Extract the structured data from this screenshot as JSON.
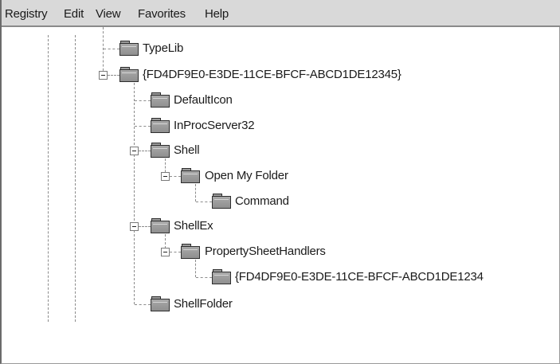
{
  "menubar": {
    "registry": "Registry",
    "edit": "Edit",
    "view": "View",
    "favorites": "Favorites",
    "help": "Help"
  },
  "tree": {
    "typelib": "TypeLib",
    "clsid_root": "{FD4DF9E0-E3DE-11CE-BFCF-ABCD1DE12345}",
    "defaulticon": "DefaultIcon",
    "inprocserver32": "InProcServer32",
    "shell": "Shell",
    "open_my_folder": "Open My Folder",
    "command": "Command",
    "shellex": "ShellEx",
    "propertysheethandlers": "PropertySheetHandlers",
    "clsid_handler": "{FD4DF9E0-E3DE-11CE-BFCF-ABCD1DE1234",
    "shellfolder": "ShellFolder"
  },
  "icons": {
    "folder": "folder-icon",
    "collapse": "minus-box-icon"
  },
  "colors": {
    "menubar_bg": "#d9d9d9",
    "folder_fill": "#9a9a9a",
    "tree_line": "#8c8c8c"
  }
}
